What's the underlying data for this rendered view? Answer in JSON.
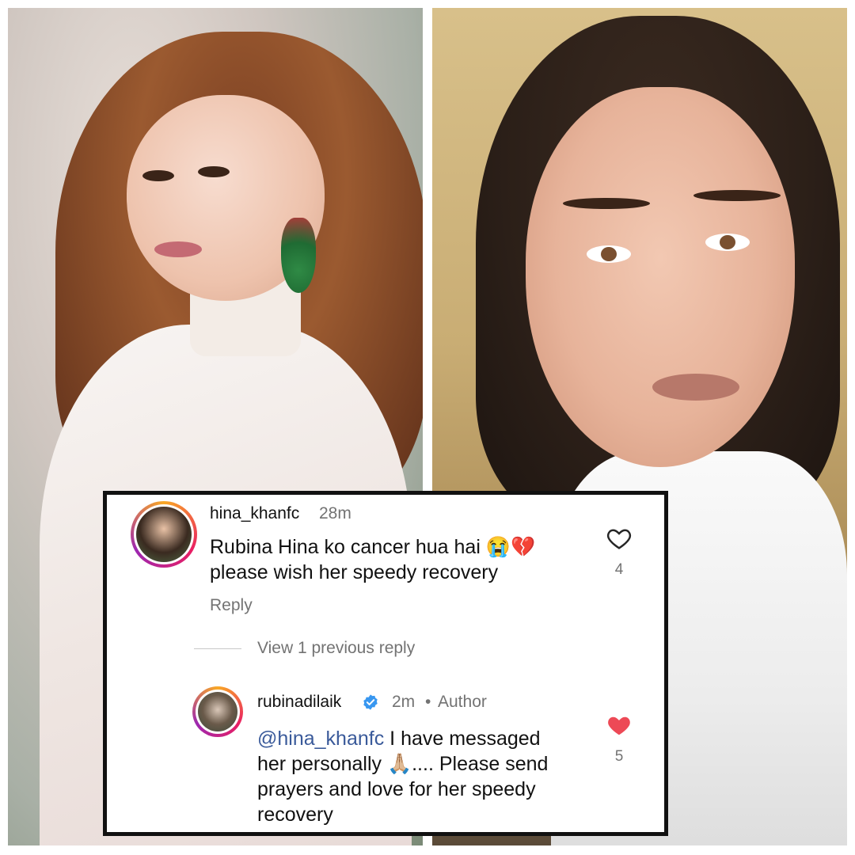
{
  "comments": [
    {
      "username": "hina_khanfc",
      "time": "28m",
      "text": "Rubina Hina ko cancer hua hai 😭💔 please wish her speedy recovery",
      "reply_label": "Reply",
      "likes": "4",
      "liked": false,
      "like_icon": "heart-outline-icon"
    },
    {
      "username": "rubinadilaik",
      "verified": true,
      "time": "2m",
      "separator": "•",
      "badge": "Author",
      "mention": "@hina_khanfc",
      "text": "I have  messaged her personally 🙏🏼.... Please send prayers and love for her speedy recovery",
      "likes": "5",
      "liked": true,
      "like_icon": "heart-filled-icon"
    }
  ],
  "view_replies_label": "View 1 previous reply",
  "colors": {
    "liked_heart": "#ed4956",
    "mention": "#3a5a9a",
    "verified_badge": "#3897f0",
    "muted_text": "#737373"
  }
}
